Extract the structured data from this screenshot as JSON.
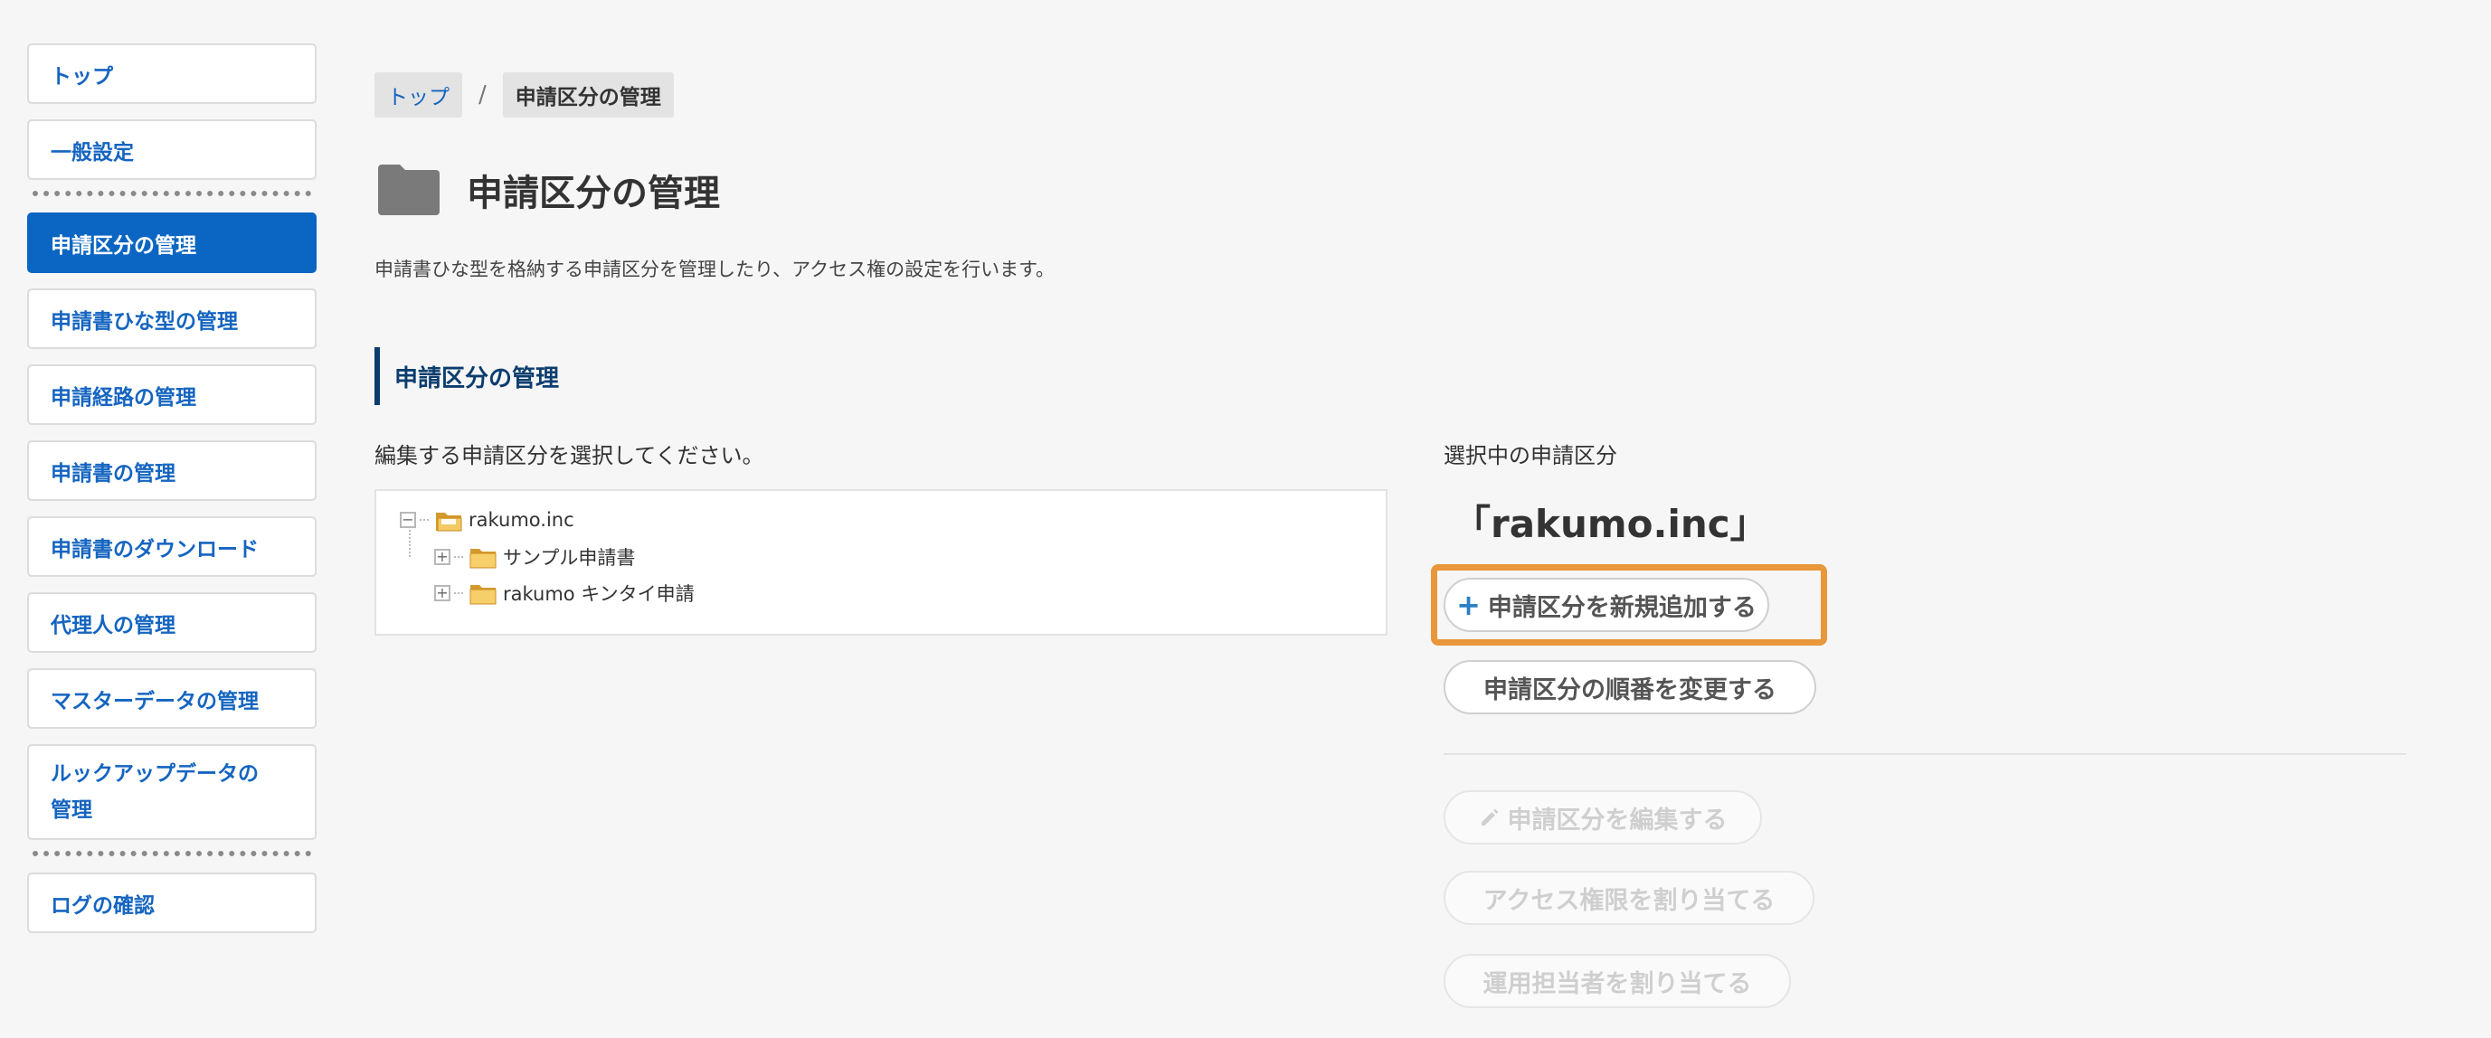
{
  "sidebar": {
    "items": [
      {
        "label": "トップ"
      },
      {
        "label": "一般設定"
      },
      {
        "label": "申請区分の管理"
      },
      {
        "label": "申請書ひな型の管理"
      },
      {
        "label": "申請経路の管理"
      },
      {
        "label": "申請書の管理"
      },
      {
        "label": "申請書のダウンロード"
      },
      {
        "label": "代理人の管理"
      },
      {
        "label": "マスターデータの管理"
      },
      {
        "label": "ルックアップデータの",
        "label2": "管理"
      },
      {
        "label": "ログの確認"
      }
    ],
    "active_color": "#0a66c2"
  },
  "breadcrumb": {
    "top": "トップ",
    "separator": "/",
    "current": "申請区分の管理"
  },
  "page": {
    "title": "申請区分の管理",
    "description": "申請書ひな型を格納する申請区分を管理したり、アクセス権の設定を行います。",
    "section_title": "申請区分の管理",
    "instruction": "編集する申請区分を選択してください。"
  },
  "tree": {
    "root": {
      "label": "rakumo.inc",
      "toggle": "−"
    },
    "children": [
      {
        "label": "サンプル申請書",
        "toggle": "+"
      },
      {
        "label": "rakumo キンタイ申請",
        "toggle": "+"
      }
    ]
  },
  "selection": {
    "label": "選択中の申請区分",
    "value": "「rakumo.inc」"
  },
  "actions": {
    "add": {
      "icon": "+",
      "label": "申請区分を新規追加する"
    },
    "reorder": {
      "label": "申請区分の順番を変更する"
    },
    "edit": {
      "label": "申請区分を編集する"
    },
    "access": {
      "label": "アクセス権限を割り当てる"
    },
    "operator": {
      "label": "運用担当者を割り当てる"
    }
  },
  "colors": {
    "highlight": "#e8973a",
    "link": "#1565c0",
    "section_accent": "#0b3d6e"
  }
}
